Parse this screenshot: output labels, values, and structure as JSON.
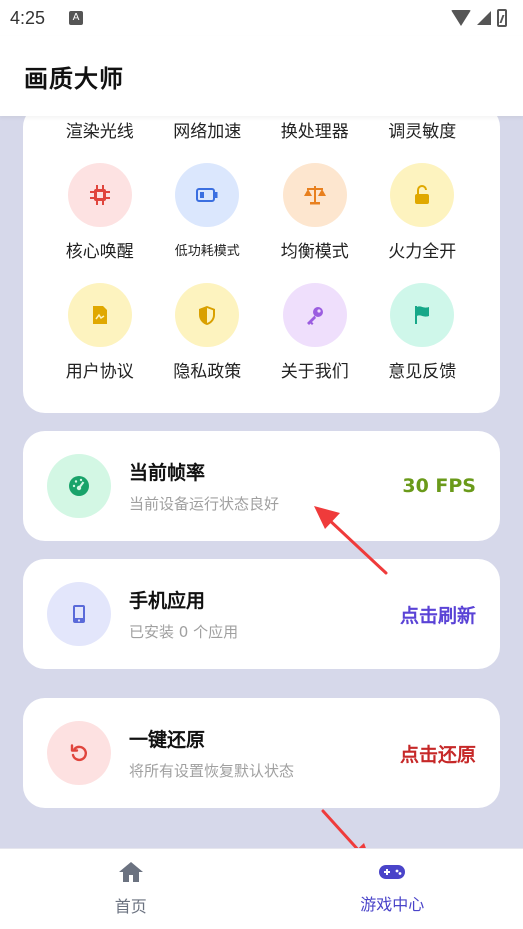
{
  "status_bar": {
    "time": "4:25",
    "notification_glyph": "A"
  },
  "app_bar": {
    "title": "画质大师"
  },
  "grid": {
    "row_top_labels": [
      "渲染光线",
      "网络加速",
      "换处理器",
      "调灵敏度"
    ],
    "row_mid": [
      {
        "label": "核心唤醒",
        "icon": "chip-icon",
        "bg": "#fde2e2",
        "fg": "#e0453d"
      },
      {
        "label": "低功耗模式",
        "icon": "battery-low-icon",
        "bg": "#dbe7fd",
        "fg": "#3b6fe0"
      },
      {
        "label": "均衡模式",
        "icon": "balance-scale-icon",
        "bg": "#fde6cf",
        "fg": "#e8801f"
      },
      {
        "label": "火力全开",
        "icon": "unlock-icon",
        "bg": "#fdf3bf",
        "fg": "#e0a800"
      }
    ],
    "row_bottom": [
      {
        "label": "用户协议",
        "icon": "document-icon",
        "bg": "#fdf3bf",
        "fg": "#e0a800"
      },
      {
        "label": "隐私政策",
        "icon": "shield-icon",
        "bg": "#fdf3bf",
        "fg": "#d9a000"
      },
      {
        "label": "关于我们",
        "icon": "key-icon",
        "bg": "#efdffc",
        "fg": "#9b5de0"
      },
      {
        "label": "意见反馈",
        "icon": "flag-icon",
        "bg": "#cff7ea",
        "fg": "#17a889"
      }
    ]
  },
  "cards": {
    "fps": {
      "title": "当前帧率",
      "subtitle": "当前设备运行状态良好",
      "action": "30 FPS",
      "action_color": "#6a9a1a",
      "icon": "speedometer-icon",
      "icon_bg": "#d3f7e4",
      "icon_fg": "#19a36a"
    },
    "apps": {
      "title": "手机应用",
      "subtitle": "已安装 0 个应用",
      "action": "点击刷新",
      "action_color": "#5a43d6",
      "icon": "phone-icon",
      "icon_bg": "#e3e6fb",
      "icon_fg": "#5a6ad9"
    },
    "reset": {
      "title": "一键还原",
      "subtitle": "将所有设置恢复默认状态",
      "action": "点击还原",
      "action_color": "#c62828",
      "icon": "restore-icon",
      "icon_bg": "#fde1e1",
      "icon_fg": "#e0453d"
    }
  },
  "bottom_nav": {
    "home": {
      "label": "首页",
      "icon": "home-icon",
      "color": "#6b7280"
    },
    "game_center": {
      "label": "游戏中心",
      "icon": "gamepad-icon",
      "color": "#4a44c9"
    }
  }
}
